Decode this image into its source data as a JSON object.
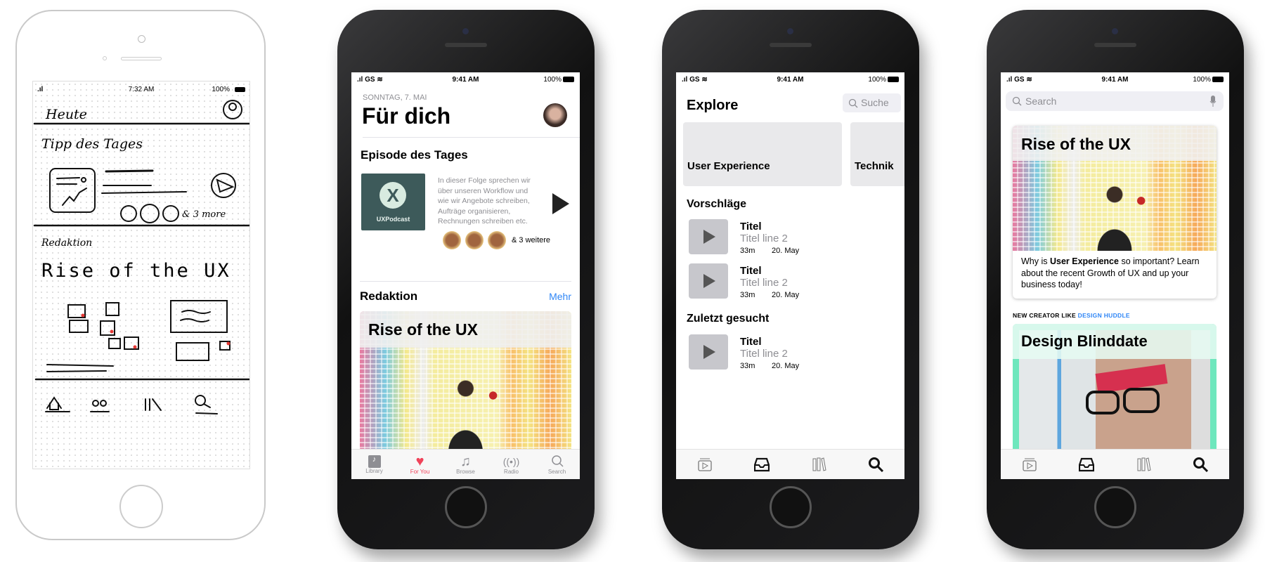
{
  "sketch": {
    "status": {
      "time": "7:32 AM",
      "battery": "100%"
    },
    "header": "Heute",
    "section1": "Tipp des Tages",
    "more": "& 3 more",
    "section2": "Redaktion",
    "headline": "Rise of the UX"
  },
  "foryou": {
    "status": {
      "carrier": "GS",
      "time": "9:41 AM",
      "battery": "100%"
    },
    "date": "SONNTAG, 7. MAI",
    "title": "Für dich",
    "episode": {
      "heading": "Episode des Tages",
      "artwork_label": "UXPodcast",
      "description": "In dieser Folge sprechen wir über unseren Workflow und wie wir Angebote schreiben, Aufträge organisieren, Rechnungen schreiben etc.",
      "participants_more": "& 3 weitere"
    },
    "redaktion": {
      "heading": "Redaktion",
      "more_link": "Mehr",
      "card_title": "Rise of the UX"
    },
    "tabs": [
      {
        "label": "Library",
        "icon": "library-icon"
      },
      {
        "label": "For You",
        "icon": "heart-icon",
        "active": true
      },
      {
        "label": "Browse",
        "icon": "music-note-icon"
      },
      {
        "label": "Radio",
        "icon": "radio-icon"
      },
      {
        "label": "Search",
        "icon": "search-icon"
      }
    ],
    "accent": "#f0435a",
    "link_color": "#2f86f6"
  },
  "explore": {
    "status": {
      "carrier": "GS",
      "time": "9:41 AM",
      "battery": "100%"
    },
    "title": "Explore",
    "search_placeholder": "Suche",
    "categories": [
      "User Experience",
      "Technik"
    ],
    "suggestions_heading": "Vorschläge",
    "suggestions": [
      {
        "title": "Titel",
        "subtitle": "Titel line 2",
        "duration": "33m",
        "date": "20. May"
      },
      {
        "title": "Titel",
        "subtitle": "Titel line 2",
        "duration": "33m",
        "date": "20. May"
      }
    ],
    "recent_heading": "Zuletzt gesucht",
    "recent": [
      {
        "title": "Titel",
        "subtitle": "Titel line 2",
        "duration": "33m",
        "date": "20. May"
      }
    ],
    "tabs": [
      "episodes-icon",
      "inbox-icon",
      "library-icon",
      "search-icon"
    ],
    "active_tab": "search-icon"
  },
  "discover": {
    "status": {
      "carrier": "GS",
      "time": "9:41 AM",
      "battery": "100%"
    },
    "search_placeholder": "Search",
    "card1": {
      "title": "Rise of the UX",
      "text_pre": "Why is ",
      "text_bold": "User Experience",
      "text_post": " so important? Learn about the recent Growth of UX and up your business today!"
    },
    "creator_label": "NEW CREATOR LIKE",
    "creator_name": "DESIGN HUDDLE",
    "card2": {
      "title": "Design Blinddate"
    },
    "accent_green": "#6ee7bd",
    "tabs": [
      "episodes-icon",
      "inbox-icon",
      "library-icon",
      "search-icon"
    ],
    "active_tab": "search-icon"
  }
}
